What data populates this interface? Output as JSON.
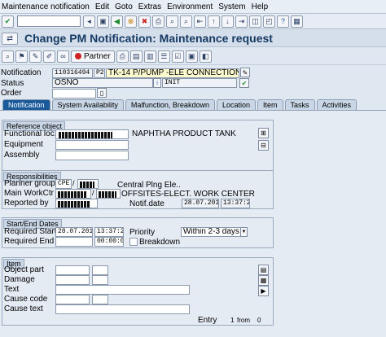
{
  "menu": [
    "Maintenance notification",
    "Edit",
    "Goto",
    "Extras",
    "Environment",
    "System",
    "Help"
  ],
  "window_title": "Change PM Notification: Maintenance request",
  "partner_label": "Partner",
  "header": {
    "notification_label": "Notification",
    "notification_no": "110316494",
    "notification_type": "P2",
    "notification_text": "TK-14 P/PUMP -ELE CONNECTION TO",
    "status_label": "Status",
    "status_value": "OSNO",
    "status_code": "INIT",
    "order_label": "Order"
  },
  "tabs": [
    "Notification",
    "System Availability",
    "Malfunction, Breakdown",
    "Location",
    "Item",
    "Tasks",
    "Activities"
  ],
  "reference": {
    "title": "Reference object",
    "functional_loc_label": "Functional loc.",
    "functional_loc_desc": "NAPHTHA PRODUCT TANK",
    "equipment_label": "Equipment",
    "assembly_label": "Assembly"
  },
  "responsibilities": {
    "title": "Responsibilities",
    "planner_group_label": "Planner group",
    "planner_group_value": "CPE",
    "planner_group_desc": "Central Plng Ele..",
    "main_workctr_label": "Main WorkCtr",
    "main_workctr_desc": "OFFSITES-ELECT. WORK CENTER",
    "reported_by_label": "Reported by",
    "notif_date_label": "Notif.date",
    "notif_date": "28.07.2012",
    "notif_time": "13:37:22"
  },
  "dates": {
    "title": "Start/End Dates",
    "required_start_label": "Required Start",
    "required_start_date": "28.07.2012",
    "required_start_time": "13:37:22",
    "required_end_label": "Required End",
    "required_end_time": "00:00:00",
    "priority_label": "Priority",
    "priority_value": "Within 2-3 days",
    "breakdown_label": "Breakdown"
  },
  "item": {
    "title": "Item",
    "object_part_label": "Object part",
    "damage_label": "Damage",
    "text_label": "Text",
    "cause_code_label": "Cause code",
    "cause_text_label": "Cause text",
    "entry_label": "Entry",
    "entry_value": "1",
    "entry_from": "from",
    "entry_total": "0"
  }
}
